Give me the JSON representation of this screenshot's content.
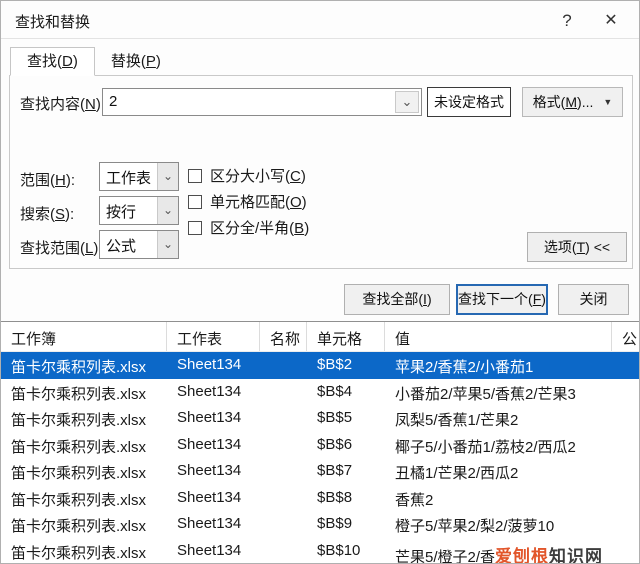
{
  "dialog": {
    "title": "查找和替换",
    "help_icon": "?",
    "close_icon": "✕"
  },
  "tabs": [
    {
      "label": "查找(D)",
      "active": true
    },
    {
      "label": "替换(P)",
      "active": false
    }
  ],
  "find_row": {
    "label": "查找内容(N):",
    "value": "2",
    "dropdown_icon": "⌄",
    "preview_label": "未设定格式",
    "format_button": "格式(M)...",
    "format_arrow_icon": "▼"
  },
  "options": {
    "within": {
      "label": "范围(H):",
      "value": "工作表",
      "dropdown_icon": "⌄"
    },
    "search": {
      "label": "搜索(S):",
      "value": "按行",
      "dropdown_icon": "⌄"
    },
    "look_in": {
      "label": "查找范围(L):",
      "value": "公式",
      "dropdown_icon": "⌄"
    },
    "checkboxes": [
      {
        "label": "区分大小写(C)",
        "checked": false
      },
      {
        "label": "单元格匹配(O)",
        "checked": false
      },
      {
        "label": "区分全/半角(B)",
        "checked": false
      }
    ],
    "options_button": "选项(T) <<"
  },
  "actions": {
    "find_all": "查找全部(I)",
    "find_next": "查找下一个(F)",
    "close": "关闭"
  },
  "results": {
    "columns": [
      "工作簿",
      "工作表",
      "名称",
      "单元格",
      "值",
      "公"
    ],
    "rows": [
      {
        "workbook": "笛卡尔乘积列表.xlsx",
        "sheet": "Sheet134",
        "name": "",
        "cell": "$B$2",
        "value": "苹果2/香蕉2/小番茄1",
        "selected": true,
        "watermark": false
      },
      {
        "workbook": "笛卡尔乘积列表.xlsx",
        "sheet": "Sheet134",
        "name": "",
        "cell": "$B$4",
        "value": "小番茄2/苹果5/香蕉2/芒果3",
        "selected": false,
        "watermark": false
      },
      {
        "workbook": "笛卡尔乘积列表.xlsx",
        "sheet": "Sheet134",
        "name": "",
        "cell": "$B$5",
        "value": "凤梨5/香蕉1/芒果2",
        "selected": false,
        "watermark": false
      },
      {
        "workbook": "笛卡尔乘积列表.xlsx",
        "sheet": "Sheet134",
        "name": "",
        "cell": "$B$6",
        "value": "椰子5/小番茄1/荔枝2/西瓜2",
        "selected": false,
        "watermark": false
      },
      {
        "workbook": "笛卡尔乘积列表.xlsx",
        "sheet": "Sheet134",
        "name": "",
        "cell": "$B$7",
        "value": "丑橘1/芒果2/西瓜2",
        "selected": false,
        "watermark": false
      },
      {
        "workbook": "笛卡尔乘积列表.xlsx",
        "sheet": "Sheet134",
        "name": "",
        "cell": "$B$8",
        "value": "香蕉2",
        "selected": false,
        "watermark": false
      },
      {
        "workbook": "笛卡尔乘积列表.xlsx",
        "sheet": "Sheet134",
        "name": "",
        "cell": "$B$9",
        "value": "橙子5/苹果2/梨2/菠萝10",
        "selected": false,
        "watermark": false
      },
      {
        "workbook": "笛卡尔乘积列表.xlsx",
        "sheet": "Sheet134",
        "name": "",
        "cell": "$B$10",
        "value": "芒果5/橙子2/香",
        "selected": false,
        "watermark": true
      }
    ]
  },
  "watermark": {
    "part1": "爱刨根",
    "part2": "知识网",
    "color1": "#e2562b",
    "color2": "#3d3d3d"
  },
  "colors": {
    "selection_blue": "#0c68c8",
    "default_button_border": "#2668b2"
  }
}
